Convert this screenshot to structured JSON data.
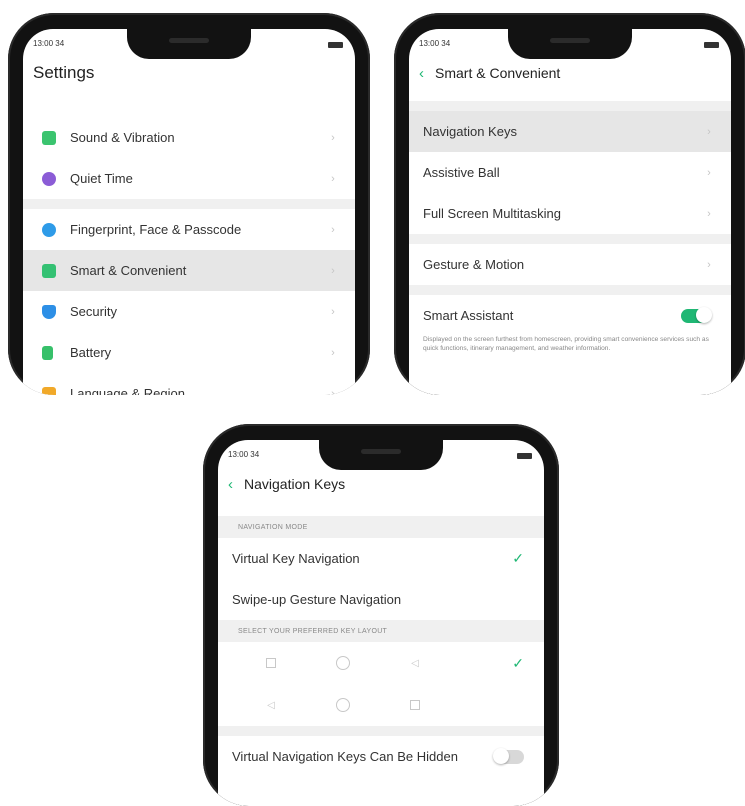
{
  "accent_color": "#1fb774",
  "status_bar": {
    "time": "13:00 34",
    "wifi_icon": "wifi-icon",
    "battery_icon": "battery-icon"
  },
  "screen_settings": {
    "title": "Settings",
    "group1": [
      {
        "label": "Sound & Vibration",
        "icon": "sound-icon",
        "color": "#3bc46f"
      },
      {
        "label": "Quiet Time",
        "icon": "moon-icon",
        "color": "#8b5cd6"
      }
    ],
    "group2": [
      {
        "label": "Fingerprint, Face & Passcode",
        "icon": "fingerprint-icon",
        "color": "#2e9be8"
      },
      {
        "label": "Smart & Convenient",
        "icon": "smart-icon",
        "color": "#34c173"
      },
      {
        "label": "Security",
        "icon": "shield-icon",
        "color": "#2d8fe6"
      },
      {
        "label": "Battery",
        "icon": "battery-setting-icon",
        "color": "#37c06a"
      },
      {
        "label": "Language & Region",
        "icon": "language-icon",
        "color": "#f1a929"
      }
    ]
  },
  "screen_smart": {
    "title": "Smart & Convenient",
    "group1": [
      "Navigation Keys",
      "Assistive Ball",
      "Full Screen Multitasking"
    ],
    "group2": [
      "Gesture & Motion"
    ],
    "smart_assistant": {
      "label": "Smart Assistant",
      "state": "on",
      "description": "Displayed on the screen furthest from homescreen, providing smart convenience services such as quick functions, itinerary management, and weather information."
    }
  },
  "screen_nav": {
    "title": "Navigation Keys",
    "section_mode": "NAVIGATION MODE",
    "modes": [
      {
        "label": "Virtual Key Navigation",
        "selected": true
      },
      {
        "label": "Swipe-up Gesture Navigation",
        "selected": false
      }
    ],
    "section_layout": "SELECT YOUR PREFERRED KEY LAYOUT",
    "layouts": [
      {
        "keys": [
          "square",
          "circle",
          "triangle"
        ],
        "selected": true
      },
      {
        "keys": [
          "triangle",
          "circle",
          "square"
        ],
        "selected": false
      }
    ],
    "hidden_toggle": {
      "label": "Virtual Navigation Keys Can Be Hidden",
      "state": "off"
    }
  }
}
